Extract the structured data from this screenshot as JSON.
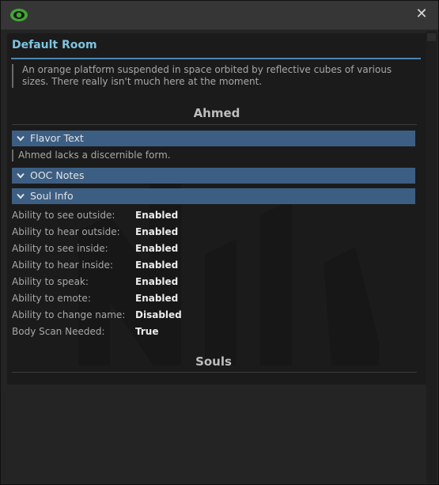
{
  "window": {
    "close_glyph": "✕",
    "accent_color": "#40a830"
  },
  "room": {
    "title": "Default Room",
    "description": "An orange platform suspended in space orbited by reflective cubes of various sizes. There really isn't much here at the moment."
  },
  "character": {
    "name": "Ahmed"
  },
  "sections": {
    "flavor": {
      "label": "Flavor Text",
      "body": "Ahmed lacks a discernible form."
    },
    "ooc": {
      "label": "OOC Notes"
    },
    "soul": {
      "label": "Soul Info"
    }
  },
  "soul_info": [
    {
      "key": "Ability to see outside:",
      "value": "Enabled"
    },
    {
      "key": "Ability to hear outside:",
      "value": "Enabled"
    },
    {
      "key": "Ability to see inside:",
      "value": "Enabled"
    },
    {
      "key": "Ability to hear inside:",
      "value": "Enabled"
    },
    {
      "key": "Ability to speak:",
      "value": "Enabled"
    },
    {
      "key": "Ability to emote:",
      "value": "Enabled"
    },
    {
      "key": "Ability to change name:",
      "value": "Disabled"
    },
    {
      "key": "Body Scan Needed:",
      "value": "True"
    }
  ],
  "souls": {
    "title": "Souls"
  }
}
